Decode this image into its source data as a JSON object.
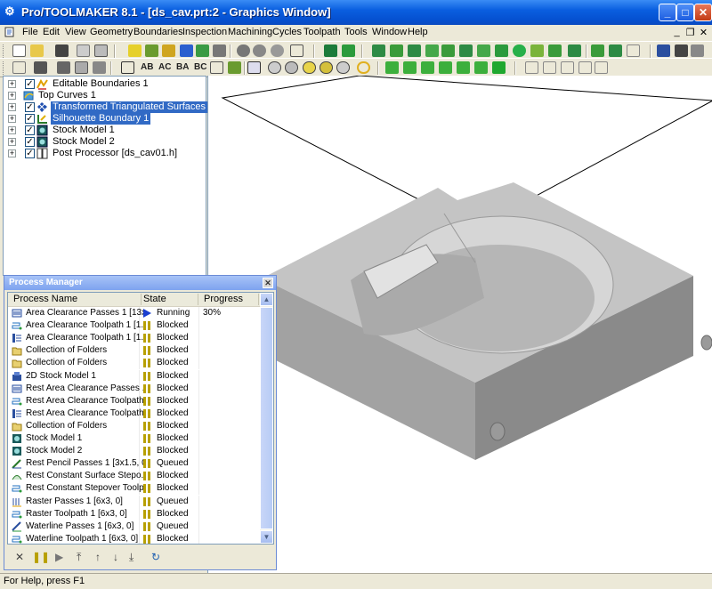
{
  "window": {
    "title": "Pro/TOOLMAKER 8.1 - [ds_cav.prt:2 - Graphics Window]",
    "minimize": "_",
    "maximize": "□",
    "close": "✕"
  },
  "menubar": {
    "items": [
      "File",
      "Edit",
      "View",
      "Geometry",
      "Boundaries",
      "Inspection",
      "Machining",
      "Cycles",
      "Toolpath",
      "Tools",
      "Window",
      "Help"
    ],
    "mdi_minimize": "_",
    "mdi_restore": "❐",
    "mdi_close": "✕"
  },
  "toolbar2": {
    "text_buttons": [
      "AB",
      "AC",
      "BA",
      "BC"
    ]
  },
  "tree": {
    "items": [
      {
        "label": "Editable Boundaries 1",
        "icon": "boundary-icon",
        "checked": true,
        "selected": false
      },
      {
        "label": "Top Curves 1",
        "icon": "curve-icon",
        "checked": false,
        "selected": false
      },
      {
        "label": "Transformed Triangulated Surfaces 1",
        "icon": "surface-icon",
        "checked": true,
        "selected": true
      },
      {
        "label": "Silhouette Boundary 1",
        "icon": "silhouette-icon",
        "checked": true,
        "selected": true
      },
      {
        "label": "Stock Model 1",
        "icon": "stock-icon",
        "checked": true,
        "selected": false
      },
      {
        "label": "Stock Model 2",
        "icon": "stock-icon",
        "checked": true,
        "selected": false
      },
      {
        "label": "Post Processor [ds_cav01.h]",
        "icon": "post-processor-icon",
        "checked": true,
        "selected": false
      }
    ]
  },
  "process_manager": {
    "title": "Process Manager",
    "columns": [
      "Process Name",
      "State",
      "Progress"
    ],
    "rows": [
      {
        "name": "Area Clearance Passes 1 [13x...",
        "state": "Running",
        "progress": "30%",
        "icon": "passes-icon"
      },
      {
        "name": "Area Clearance Toolpath 1 [1...",
        "state": "Blocked",
        "progress": "",
        "icon": "toolpath-icon"
      },
      {
        "name": "Area Clearance Toolpath 1 [1...",
        "state": "Blocked",
        "progress": "",
        "icon": "toolpath-strategy-icon"
      },
      {
        "name": "Collection of Folders",
        "state": "Blocked",
        "progress": "",
        "icon": "folder-icon"
      },
      {
        "name": "Collection of Folders",
        "state": "Blocked",
        "progress": "",
        "icon": "folder-icon"
      },
      {
        "name": "2D Stock Model 1",
        "state": "Blocked",
        "progress": "",
        "icon": "stock2d-icon"
      },
      {
        "name": "Rest Area Clearance Passes ...",
        "state": "Blocked",
        "progress": "",
        "icon": "passes-icon"
      },
      {
        "name": "Rest Area Clearance Toolpath...",
        "state": "Blocked",
        "progress": "",
        "icon": "toolpath-icon"
      },
      {
        "name": "Rest Area Clearance Toolpath...",
        "state": "Blocked",
        "progress": "",
        "icon": "toolpath-strategy-icon"
      },
      {
        "name": "Collection of Folders",
        "state": "Blocked",
        "progress": "",
        "icon": "folder-icon"
      },
      {
        "name": "Stock Model 1",
        "state": "Blocked",
        "progress": "",
        "icon": "stock-icon"
      },
      {
        "name": "Stock Model 2",
        "state": "Blocked",
        "progress": "",
        "icon": "stock-icon"
      },
      {
        "name": "Rest Pencil Passes 1 [3x1.5, 0]",
        "state": "Queued",
        "progress": "",
        "icon": "pencil-passes-icon"
      },
      {
        "name": "Rest Constant Surface Stepo...",
        "state": "Blocked",
        "progress": "",
        "icon": "surface-stepover-icon"
      },
      {
        "name": "Rest Constant Stepover Toolp...",
        "state": "Blocked",
        "progress": "",
        "icon": "toolpath-icon"
      },
      {
        "name": "Raster Passes 1 [6x3, 0]",
        "state": "Queued",
        "progress": "",
        "icon": "raster-icon"
      },
      {
        "name": "Raster Toolpath 1 [6x3, 0]",
        "state": "Blocked",
        "progress": "",
        "icon": "toolpath-icon"
      },
      {
        "name": "Waterline Passes 1 [6x3, 0]",
        "state": "Queued",
        "progress": "",
        "icon": "waterline-icon"
      },
      {
        "name": "Waterline Toolpath 1 [6x3, 0]",
        "state": "Blocked",
        "progress": "",
        "icon": "toolpath-icon"
      }
    ],
    "tools": {
      "cancel": "✕",
      "pause": "❚❚",
      "run": "▶",
      "top": "⤒",
      "up": "↑",
      "down": "↓",
      "bottom": "⤓",
      "refresh": "↻"
    }
  },
  "status": "For Help, press F1",
  "colors": {
    "title_blue": "#0a5fe0",
    "selection": "#316ac5",
    "running": "#1a3fd0",
    "blocked": "#b8a000"
  }
}
